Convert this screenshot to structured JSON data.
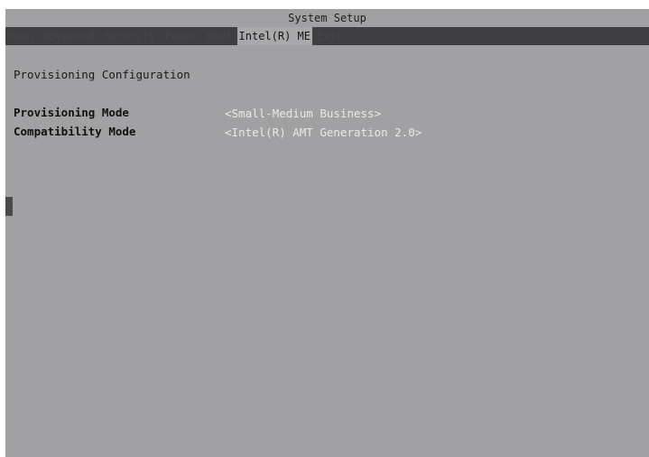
{
  "window": {
    "title": "System Setup"
  },
  "menu": {
    "items": [
      {
        "label": "Main"
      },
      {
        "label": "Advanced"
      },
      {
        "label": "Security"
      },
      {
        "label": "Power"
      },
      {
        "label": "Boot"
      },
      {
        "label": "Intel(R) ME"
      },
      {
        "label": "Exit"
      }
    ],
    "active_index": 5
  },
  "page": {
    "heading": "Provisioning Configuration",
    "settings": [
      {
        "label": "Provisioning Mode",
        "value": "<Small-Medium Business>"
      },
      {
        "label": "Compatibility Mode",
        "value": "<Intel(R) AMT Generation 2.0>"
      }
    ]
  },
  "colors": {
    "screen_background": "#a1a1a4",
    "menu_background": "#3f3f42",
    "active_tab_background": "#a9a9ac",
    "value_text": "#e9e9e9",
    "label_text": "#111111"
  }
}
